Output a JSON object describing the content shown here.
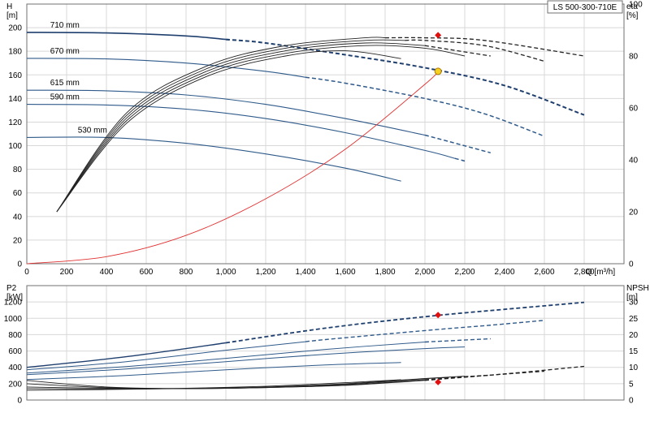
{
  "colors": {
    "grid": "#d8d8d8",
    "frame": "#707070",
    "curve_dark": "#1f3f6e",
    "curve_mid": "#2f5a8a",
    "system": "#e03030",
    "efficiency": "#222222",
    "duty_point": "#f5d020",
    "marker": "#e01010"
  },
  "chart_data": [
    {
      "type": "line",
      "title": "LS 500-300-710E",
      "xlabel": "Q [m³/h]",
      "ylabel": "H",
      "ylabel_unit": "[m]",
      "y2label": "eta",
      "y2label_unit": "[%]",
      "grid": true,
      "xlim": [
        0,
        3000
      ],
      "ylim": [
        0,
        220
      ],
      "y2lim": [
        0,
        100
      ],
      "x_ticks": [
        "0",
        "200",
        "400",
        "600",
        "800",
        "1,000",
        "1,200",
        "1,400",
        "1,600",
        "1,800",
        "2,000",
        "2,200",
        "2,400",
        "2,600",
        "2,800"
      ],
      "y_ticks": [
        "0",
        "20",
        "40",
        "60",
        "80",
        "100",
        "120",
        "140",
        "160",
        "180",
        "200"
      ],
      "y2_ticks": [
        "0",
        "20",
        "40",
        "60",
        "80",
        "100"
      ],
      "head_curves": [
        {
          "name": "710 mm",
          "x": [
            0,
            400,
            800,
            1200,
            1600,
            2000,
            2400,
            2800
          ],
          "y": [
            196,
            195.5,
            193,
            187,
            177,
            166,
            151,
            126
          ],
          "solid_until": 1000,
          "bold": true
        },
        {
          "name": "670 mm",
          "x": [
            0,
            400,
            800,
            1200,
            1600,
            2000,
            2300,
            2600
          ],
          "y": [
            174,
            173.5,
            170,
            163,
            153,
            140,
            127,
            108
          ],
          "solid_until": 1400,
          "bold": false
        },
        {
          "name": "615 mm",
          "x": [
            0,
            400,
            800,
            1200,
            1600,
            2000,
            2330
          ],
          "y": [
            147,
            146.5,
            143,
            135,
            123,
            109,
            94
          ],
          "solid_until": 2000,
          "bold": false
        },
        {
          "name": "590 mm",
          "x": [
            0,
            400,
            800,
            1200,
            1600,
            2000,
            2200
          ],
          "y": [
            135,
            134.5,
            131,
            123,
            111,
            96,
            87
          ],
          "solid_until": 2150,
          "bold": false
        },
        {
          "name": "530 mm",
          "x": [
            0,
            400,
            800,
            1200,
            1600,
            1880
          ],
          "y": [
            107,
            107,
            102,
            93,
            81,
            70
          ],
          "solid_until": 1880,
          "bold": false
        }
      ],
      "system_curve": {
        "x": [
          0,
          400,
          800,
          1200,
          1600,
          2000,
          2066
        ],
        "y": [
          0,
          6,
          24,
          55,
          97,
          152,
          163
        ]
      },
      "efficiency_curves": [
        {
          "x": [
            150,
            500,
            900,
            1300,
            1700,
            2000,
            2300,
            2800
          ],
          "y": [
            20,
            58,
            76,
            84,
            87,
            87,
            86,
            80
          ],
          "solid_until": 1800
        },
        {
          "x": [
            150,
            500,
            900,
            1300,
            1700,
            2000,
            2300,
            2600
          ],
          "y": [
            20,
            57,
            75,
            83,
            86,
            86,
            84,
            78
          ],
          "solid_until": 1900
        },
        {
          "x": [
            150,
            500,
            900,
            1300,
            1700,
            2000,
            2330
          ],
          "y": [
            20,
            56,
            74,
            82,
            85,
            84,
            80
          ],
          "solid_until": 2000
        },
        {
          "x": [
            150,
            500,
            900,
            1300,
            1700,
            2000,
            2200
          ],
          "y": [
            20,
            55,
            73,
            81,
            84,
            83,
            80
          ],
          "solid_until": 2200
        },
        {
          "x": [
            150,
            500,
            900,
            1300,
            1600,
            1880
          ],
          "y": [
            20,
            54,
            72,
            80,
            82,
            79
          ],
          "solid_until": 1880
        }
      ],
      "duty_point": {
        "x": 2066,
        "y": 163
      },
      "efficiency_marker": {
        "x": 2066,
        "y2": 88
      }
    },
    {
      "type": "line",
      "ylabel": "P2",
      "ylabel_unit": "[kW]",
      "y2label": "NPSH",
      "y2label_unit": "[m]",
      "grid": true,
      "xlim": [
        0,
        3000
      ],
      "ylim": [
        0,
        1400
      ],
      "y2lim": [
        0,
        35
      ],
      "y_ticks": [
        "0",
        "200",
        "400",
        "600",
        "800",
        "1000",
        "1200"
      ],
      "y2_ticks": [
        "0",
        "5",
        "10",
        "15",
        "20",
        "25",
        "30"
      ],
      "power_curves": [
        {
          "x": [
            0,
            500,
            1000,
            1500,
            2000,
            2400,
            2800
          ],
          "y": [
            400,
            530,
            700,
            880,
            1020,
            1110,
            1195
          ],
          "solid_until": 1000,
          "bold": true
        },
        {
          "x": [
            0,
            500,
            1000,
            1500,
            2000,
            2300,
            2600
          ],
          "y": [
            370,
            470,
            610,
            740,
            850,
            910,
            975
          ],
          "solid_until": 1400,
          "bold": false
        },
        {
          "x": [
            0,
            500,
            1000,
            1500,
            2000,
            2330
          ],
          "y": [
            330,
            410,
            510,
            620,
            710,
            750
          ],
          "solid_until": 2000,
          "bold": false
        },
        {
          "x": [
            0,
            500,
            1000,
            1500,
            2000,
            2200
          ],
          "y": [
            310,
            380,
            470,
            560,
            630,
            650
          ],
          "solid_until": 2200,
          "bold": false
        },
        {
          "x": [
            0,
            500,
            1000,
            1500,
            1880
          ],
          "y": [
            250,
            300,
            370,
            430,
            460
          ],
          "solid_until": 1880,
          "bold": false
        }
      ],
      "npsh_curves": [
        {
          "x": [
            0,
            400,
            800,
            1200,
            1600,
            2000,
            2400,
            2800
          ],
          "y2": [
            6,
            4,
            3.5,
            3.8,
            4.5,
            6,
            8,
            10.3
          ],
          "solid_until": 2000
        },
        {
          "x": [
            0,
            400,
            800,
            1200,
            1600,
            2000,
            2300,
            2600
          ],
          "y2": [
            5,
            3.8,
            3.5,
            3.8,
            4.6,
            6.2,
            7.5,
            8.8
          ],
          "solid_until": 2000
        },
        {
          "x": [
            0,
            400,
            800,
            1200,
            1600,
            2000,
            2330
          ],
          "y2": [
            4,
            3.6,
            3.5,
            3.9,
            4.8,
            6.5,
            7.6
          ],
          "solid_until": 2100
        },
        {
          "x": [
            0,
            400,
            800,
            1200,
            1600,
            2000,
            2200
          ],
          "y2": [
            3.5,
            3.4,
            3.5,
            4,
            5,
            6.6,
            7.3
          ],
          "solid_until": 2200
        },
        {
          "x": [
            0,
            400,
            800,
            1200,
            1600,
            1880
          ],
          "y2": [
            3,
            3.2,
            3.6,
            4.2,
            5.3,
            6.2
          ],
          "solid_until": 1880
        }
      ],
      "power_marker": {
        "x": 2066,
        "y": 1040
      },
      "npsh_marker": {
        "x": 2066,
        "y2": 5.5
      }
    }
  ]
}
